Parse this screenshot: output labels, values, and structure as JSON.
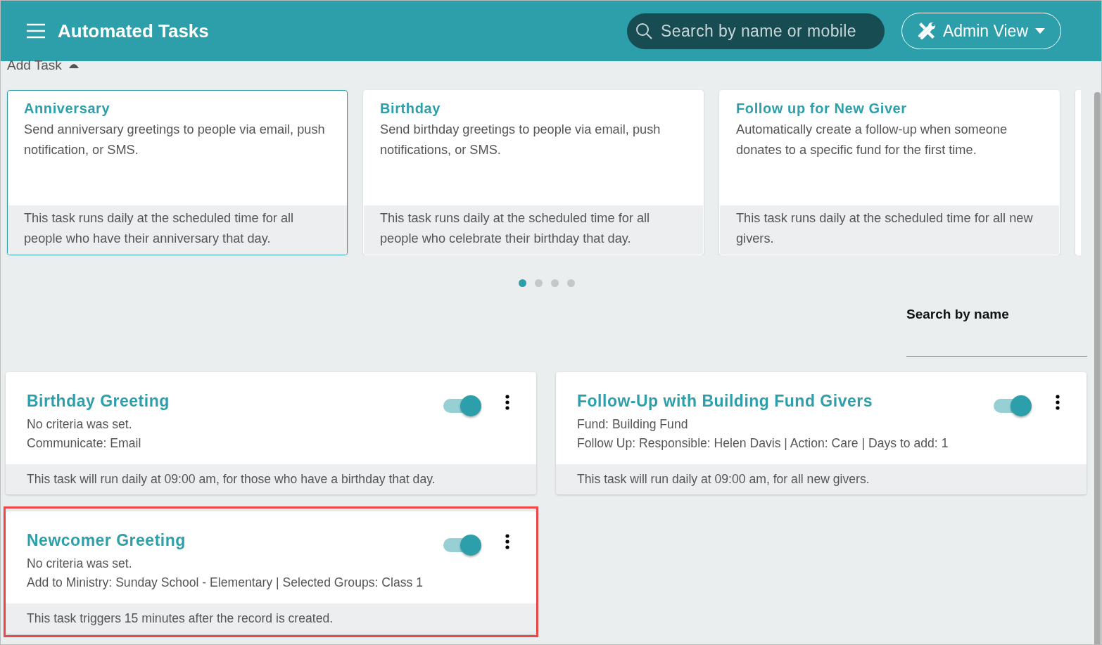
{
  "header": {
    "title": "Automated Tasks",
    "search": {
      "placeholder": "Search by name or mobile"
    },
    "view_button": {
      "label": "Admin View"
    }
  },
  "add_task": {
    "label": "Add Task",
    "expanded": true
  },
  "templates": [
    {
      "title": "Anniversary",
      "description": "Send anniversary greetings to people via email, push notification, or SMS.",
      "footer": "This task runs daily at the scheduled time for all people who have their anniversary that day.",
      "selected": true
    },
    {
      "title": "Birthday",
      "description": "Send birthday greetings to people via email, push notifications, or SMS.",
      "footer": "This task runs daily at the scheduled time for all people who celebrate their birthday that day.",
      "selected": false
    },
    {
      "title": "Follow up for New Giver",
      "description": "Automatically create a follow-up when someone donates to a specific fund for the first time.",
      "footer": "This task runs daily at the scheduled time for all new givers.",
      "selected": false
    }
  ],
  "carousel_dots": [
    {
      "selected": true
    },
    {
      "selected": false
    },
    {
      "selected": false
    },
    {
      "selected": false
    }
  ],
  "name_search": {
    "label": "Search by name"
  },
  "tasks": [
    {
      "title": "Birthday Greeting",
      "details": [
        "No criteria was set.",
        "Communicate: Email"
      ],
      "footer": "This task will run daily at 09:00 am, for those who have a birthday that day.",
      "on": true,
      "highlighted": false
    },
    {
      "title": "Follow-Up with Building Fund Givers",
      "details": [
        "Fund: Building Fund",
        "Follow Up: Responsible: Helen Davis | Action: Care | Days to add: 1"
      ],
      "footer": "This task will run daily at 09:00 am, for all new givers.",
      "on": true,
      "highlighted": false
    },
    {
      "title": "Newcomer Greeting",
      "details": [
        "No criteria was set.",
        "Add to Ministry: Sunday School - Elementary | Selected Groups: Class 1"
      ],
      "footer": "This task triggers 15 minutes after the record is created.",
      "on": true,
      "highlighted": true
    }
  ]
}
